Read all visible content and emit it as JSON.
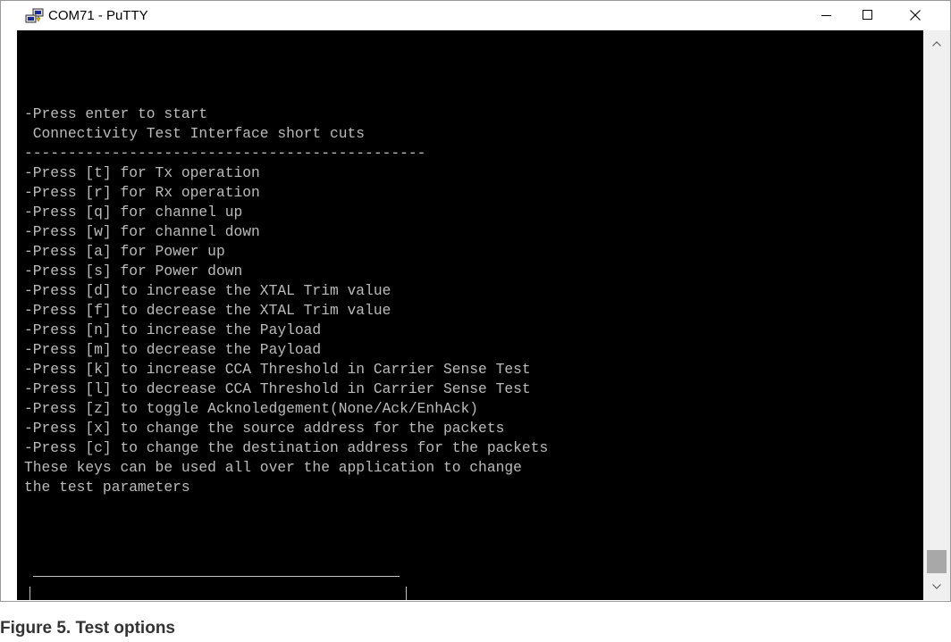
{
  "window": {
    "title": "COM71 - PuTTY",
    "icon": "putty-icon"
  },
  "controls": {
    "minimize": "minimize-icon",
    "maximize": "maximize-icon",
    "close": "close-icon"
  },
  "terminal": {
    "background": "#000000",
    "foreground": "#bbbbbb",
    "lines": [
      "-Press enter to start",
      " Connectivity Test Interface short cuts",
      "----------------------------------------------",
      "-Press [t] for Tx operation",
      "-Press [r] for Rx operation",
      "-Press [q] for channel up",
      "-Press [w] for channel down",
      "-Press [a] for Power up",
      "-Press [s] for Power down",
      "-Press [d] to increase the XTAL Trim value",
      "-Press [f] to decrease the XTAL Trim value",
      "-Press [n] to increase the Payload",
      "-Press [m] to decrease the Payload",
      "-Press [k] to increase CCA Threshold in Carrier Sense Test",
      "-Press [l] to decrease CCA Threshold in Carrier Sense Test",
      "-Press [z] to toggle Acknoledgement(None/Ack/EnhAck)",
      "-Press [x] to change the source address for the packets",
      "-Press [c] to change the destination address for the packets",
      "These keys can be used all over the application to change",
      "the test parameters"
    ]
  },
  "scrollbar": {
    "up_icon": "chevron-up-icon",
    "down_icon": "chevron-down-icon"
  },
  "caption": "Figure 5.  Test options"
}
